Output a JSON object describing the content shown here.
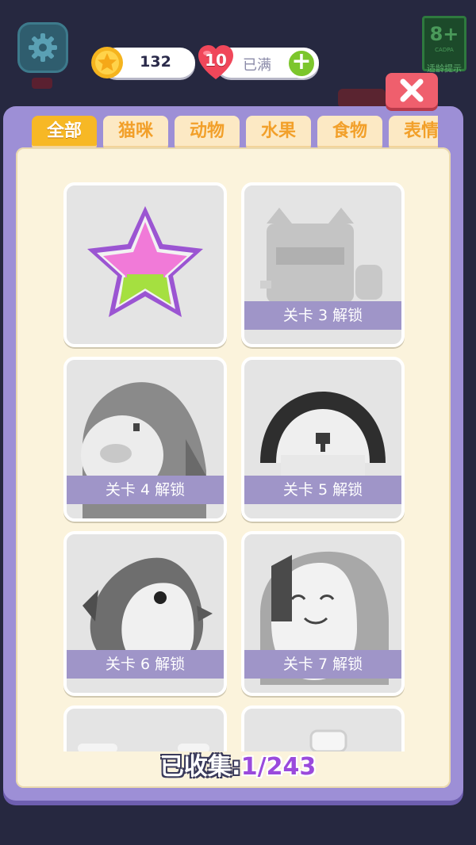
{
  "top_bar": {
    "coins": "132",
    "hearts": "10",
    "hearts_status": "已满",
    "age_rating": "8+",
    "age_rating_org": "CADPA",
    "age_caption": "适龄提示"
  },
  "tabs": [
    {
      "label": "全部",
      "active": true
    },
    {
      "label": "猫咪",
      "active": false
    },
    {
      "label": "动物",
      "active": false
    },
    {
      "label": "水果",
      "active": false
    },
    {
      "label": "食物",
      "active": false
    },
    {
      "label": "表情",
      "active": false
    }
  ],
  "cards": [
    {
      "art": "star",
      "unlocked": true,
      "lock_text": ""
    },
    {
      "art": "cat",
      "unlocked": false,
      "lock_text": "关卡 3 解锁"
    },
    {
      "art": "penguin",
      "unlocked": false,
      "lock_text": "关卡 4 解锁"
    },
    {
      "art": "dog",
      "unlocked": false,
      "lock_text": "关卡 5 解锁"
    },
    {
      "art": "shark",
      "unlocked": false,
      "lock_text": "关卡 6 解锁"
    },
    {
      "art": "face",
      "unlocked": false,
      "lock_text": "关卡 7 解锁"
    },
    {
      "art": "partial",
      "unlocked": false,
      "lock_text": ""
    },
    {
      "art": "partial2",
      "unlocked": false,
      "lock_text": ""
    }
  ],
  "collection": {
    "label": "已收集:",
    "count": "1/243"
  },
  "colors": {
    "panel": "#9d8fd6",
    "tab_active": "#f7b825",
    "close_button": "#ef5f6d",
    "plus_button": "#7cc62c",
    "count_text": "#9a4adc"
  }
}
